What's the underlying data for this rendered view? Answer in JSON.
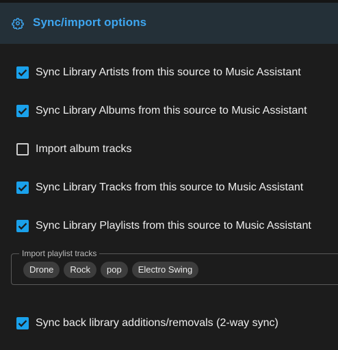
{
  "header": {
    "icon": "gear-icon",
    "title": "Sync/import options",
    "accent_color": "#3ea6f0"
  },
  "options": [
    {
      "label": "Sync Library Artists from this source to Music Assistant",
      "checked": true
    },
    {
      "label": "Sync Library Albums from this source to Music Assistant",
      "checked": true
    },
    {
      "label": "Import album tracks",
      "checked": false
    },
    {
      "label": "Sync Library Tracks from this source to Music Assistant",
      "checked": true
    },
    {
      "label": "Sync Library Playlists from this source to Music Assistant",
      "checked": true
    }
  ],
  "playlist_tracks": {
    "label": "Import playlist tracks",
    "chips": [
      "Drone",
      "Rock",
      "pop",
      "Electro Swing"
    ]
  },
  "two_way_sync": {
    "label": "Sync back library additions/removals (2-way sync)",
    "checked": true
  },
  "colors": {
    "checkbox_checked": "#1aa1eb",
    "background": "#1c1c1c",
    "header_background": "#243038"
  }
}
